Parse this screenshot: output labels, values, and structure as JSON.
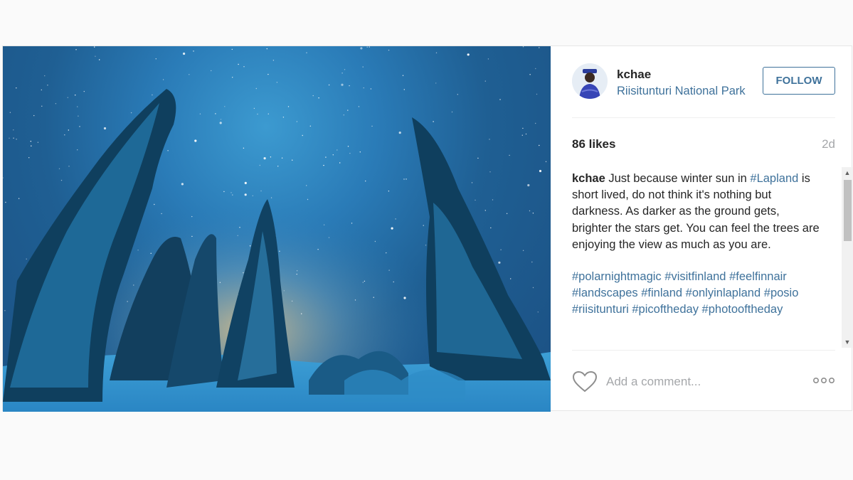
{
  "post": {
    "photo": {
      "description": "snowy trees under a starry night sky"
    },
    "header": {
      "username": "kchae",
      "location": "Riisitunturi National Park",
      "follow_label": "FOLLOW"
    },
    "likes": "86 likes",
    "age": "2d",
    "caption": {
      "username": "kchae",
      "text_before": " Just because winter sun in ",
      "tag_inline": "#Lapland",
      "text_after": " is short lived, do not think it's nothing but darkness. As darker as the ground gets, brighter the stars get. You can feel the trees are enjoying the view as much as you are.",
      "hashtags": [
        "#polarnightmagic",
        "#visitfinland",
        "#feelfinnair",
        "#landscapes",
        "#finland",
        "#onlyinlapland",
        "#posio",
        "#riisitunturi",
        "#picoftheday",
        "#photooftheday"
      ]
    },
    "comment_placeholder": "Add a comment...",
    "icons": {
      "heart": "heart-icon",
      "more": "more-options-icon"
    }
  }
}
